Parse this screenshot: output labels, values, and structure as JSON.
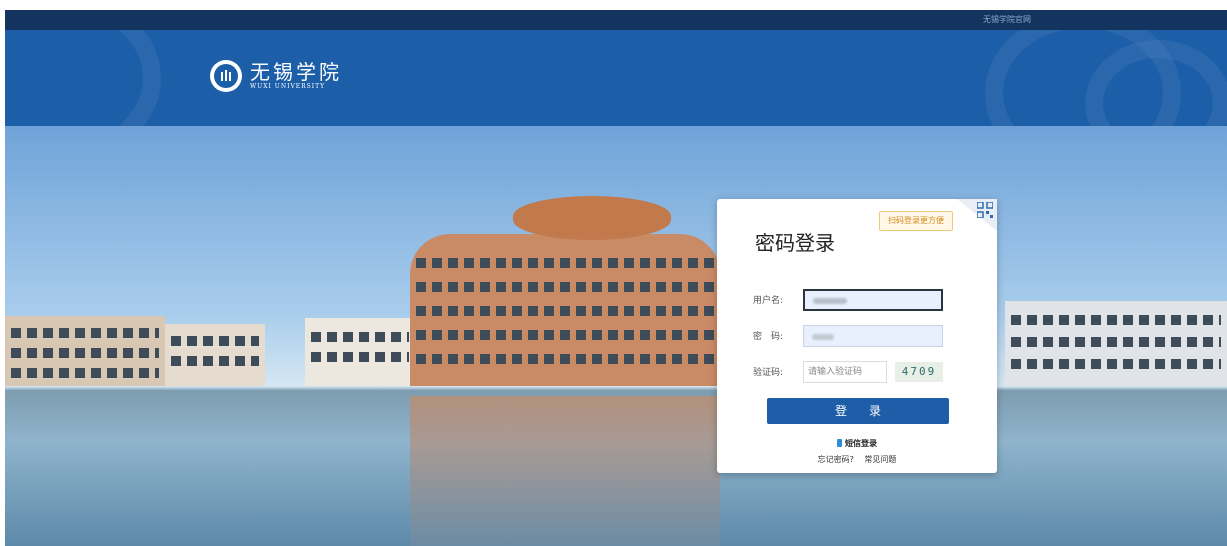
{
  "topbar": {
    "link_label": "无锡学院官网"
  },
  "header": {
    "logo_cn": "无锡学院",
    "logo_en": "WUXI UNIVERSITY"
  },
  "login": {
    "qr_tip": "扫码登录更方便",
    "title": "密码登录",
    "username_label": "用户名:",
    "password_label": "密　码:",
    "captcha_label": "验证码:",
    "captcha_placeholder": "请输入验证码",
    "captcha_code": "4709",
    "submit_label": "登录",
    "sms_login": "短信登录",
    "forgot_password": "忘记密码?",
    "faq": "常见问题"
  }
}
